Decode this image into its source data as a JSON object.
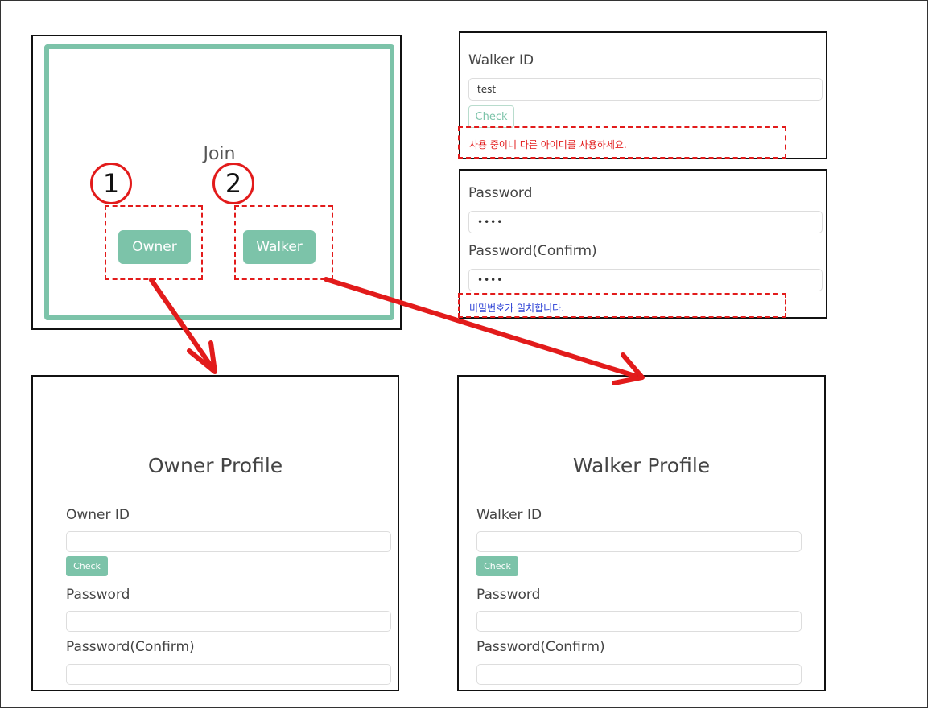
{
  "join": {
    "title": "Join",
    "owner_button": "Owner",
    "walker_button": "Walker",
    "step1": "1",
    "step2": "2"
  },
  "walker_id_check": {
    "label": "Walker ID",
    "input_value": "test",
    "check_button": "Check",
    "message": "사용 중이니 다른 아이디를 사용하세요."
  },
  "password_check": {
    "password_label": "Password",
    "password_value": "••••",
    "confirm_label": "Password(Confirm)",
    "confirm_value": "••••",
    "message": "비밀번호가 일치합니다."
  },
  "owner_profile": {
    "title": "Owner Profile",
    "id_label": "Owner ID",
    "check_button": "Check",
    "password_label": "Password",
    "confirm_label": "Password(Confirm)"
  },
  "walker_profile": {
    "title": "Walker Profile",
    "id_label": "Walker ID",
    "check_button": "Check",
    "password_label": "Password",
    "confirm_label": "Password(Confirm)"
  },
  "colors": {
    "accent": "#7cc3a9",
    "annotation": "#e21b1b",
    "error_text": "#e21b1b",
    "success_text": "#2a3fd6"
  }
}
